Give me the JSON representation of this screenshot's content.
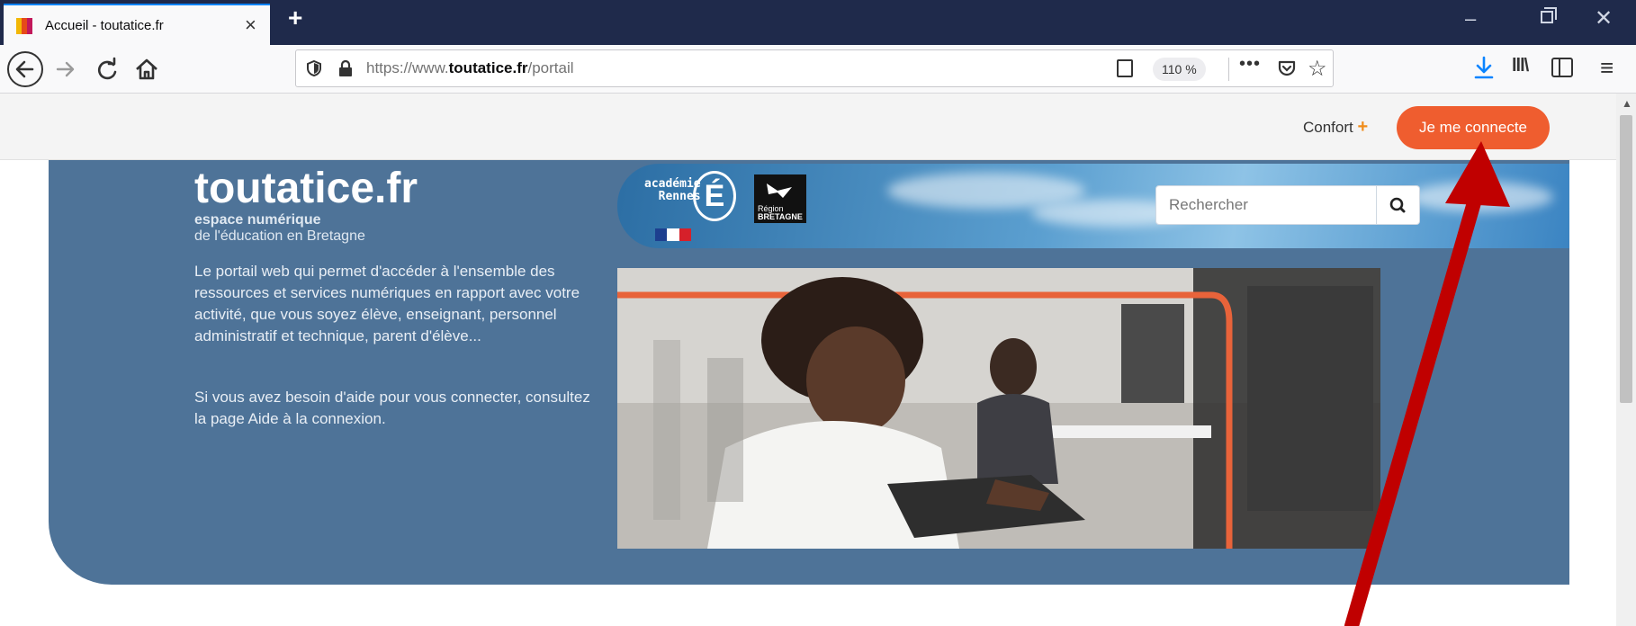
{
  "browser": {
    "tab_title": "Accueil - toutatice.fr",
    "tab_close": "×",
    "new_tab": "+",
    "url_prefix": "https://www.",
    "url_domain": "toutatice.fr",
    "url_path": "/portail",
    "zoom": "110 %",
    "more_menu": "•••",
    "star": "☆",
    "library_icon": "lll\\",
    "menu_icon": "≡",
    "window_min": "–",
    "window_close": "✕"
  },
  "colors": {
    "accent": "#0a84ff",
    "connect_button": "#ef5d2f",
    "hero_background": "#4e7398",
    "confort_plus": "#f08c1a",
    "annotation_arrow": "#c00000"
  },
  "page": {
    "confort_label": "Confort",
    "confort_plus": "+",
    "connect_label": "Je me connecte",
    "logo": "toutatice.fr",
    "tagline_line1": "espace numérique",
    "tagline_line2": "de l'éducation en Bretagne",
    "intro": "Le portail web qui permet d'accéder à l'ensemble des ressources et services numériques en rapport avec votre activité, que vous soyez élève, enseignant, personnel administratif et technique, parent d'élève...",
    "help": "Si vous avez besoin d'aide pour vous connecter, consultez la page Aide à la connexion.",
    "academie_line1": "académie",
    "academie_line2": "Rennes",
    "academie_letter": "É",
    "region_line1": "Région",
    "region_line2": "BRETAGNE",
    "search_placeholder": "Rechercher"
  },
  "icons": {
    "back": "arrow-left-icon",
    "forward": "arrow-right-icon",
    "reload": "reload-icon",
    "home": "home-icon",
    "shield": "tracking-shield-icon",
    "lock": "lock-icon",
    "reader": "reader-view-icon",
    "pocket": "pocket-icon",
    "bookmark": "star-icon",
    "download": "download-icon",
    "library": "library-icon",
    "sidebar": "sidebar-icon",
    "menu": "hamburger-icon",
    "search": "search-icon"
  }
}
